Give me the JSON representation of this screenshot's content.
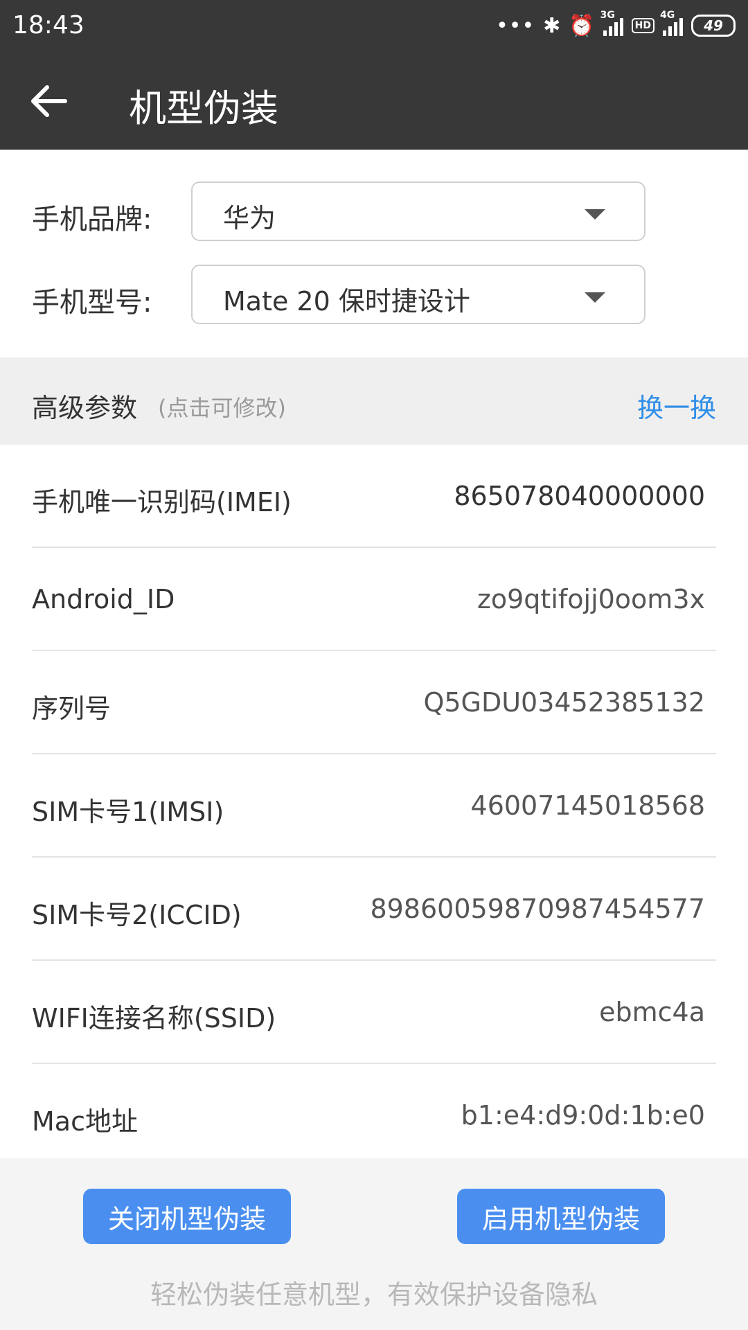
{
  "status_bar": {
    "time": "18:43",
    "dots": "•••",
    "net1_label": "3G",
    "hd_label": "HD",
    "net2_label": "4G",
    "battery": "49"
  },
  "app_bar": {
    "title": "机型伪装"
  },
  "form": {
    "brand_label": "手机品牌:",
    "brand_value": "华为",
    "model_label": "手机型号:",
    "model_value": "Mate 20 保时捷设计"
  },
  "advanced": {
    "title": "高级参数",
    "hint": "(点击可修改)",
    "swap_label": "换一换"
  },
  "params": [
    {
      "label": "手机唯一识别码(IMEI)",
      "value": "865078040000000"
    },
    {
      "label": "Android_ID",
      "value": "zo9qtifojj0oom3x"
    },
    {
      "label": "序列号",
      "value": "Q5GDU03452385132"
    },
    {
      "label": "SIM卡号1(IMSI)",
      "value": "46007145018568"
    },
    {
      "label": "SIM卡号2(ICCID)",
      "value": "89860059870987454577"
    },
    {
      "label": "WIFI连接名称(SSID)",
      "value": "ebmc4a"
    },
    {
      "label": "Mac地址",
      "value": "b1:e4:d9:0d:1b:e0"
    }
  ],
  "footer": {
    "disable_label": "关闭机型伪装",
    "enable_label": "启用机型伪装",
    "slogan": "轻松伪装任意机型，有效保护设备隐私"
  },
  "colors": {
    "header_bg": "#383838",
    "accent_blue": "#2f8ee8",
    "button_blue": "#4a8ff0"
  }
}
